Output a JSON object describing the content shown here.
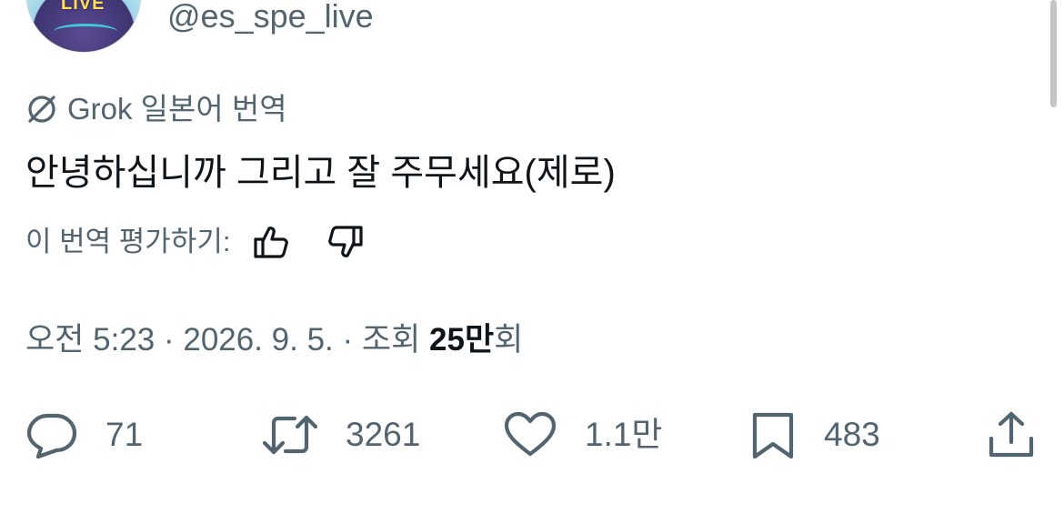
{
  "author": {
    "handle": "@es_spe_live",
    "avatar_label": "LIVE"
  },
  "translation": {
    "source_label": "Grok 일본어 번역",
    "text": "안녕하십니까 그리고 잘 주무세요(제로)",
    "rate_label": "이 번역 평가하기:"
  },
  "meta": {
    "time": "오전 5:23",
    "sep1": " · ",
    "date": "2026. 9. 5.",
    "sep2": " · ",
    "views_prefix": "조회 ",
    "views_count": "25만",
    "views_suffix": "회"
  },
  "actions": {
    "reply_count": "71",
    "retweet_count": "3261",
    "like_count": "1.1만",
    "bookmark_count": "483"
  },
  "icons": {
    "grok": "grok-icon",
    "thumb_up": "thumbs-up-icon",
    "thumb_down": "thumbs-down-icon",
    "reply": "reply-icon",
    "retweet": "retweet-icon",
    "like": "heart-icon",
    "bookmark": "bookmark-icon",
    "share": "share-icon"
  },
  "colors": {
    "secondary_text": "#536471",
    "primary_text": "#0f1419"
  }
}
